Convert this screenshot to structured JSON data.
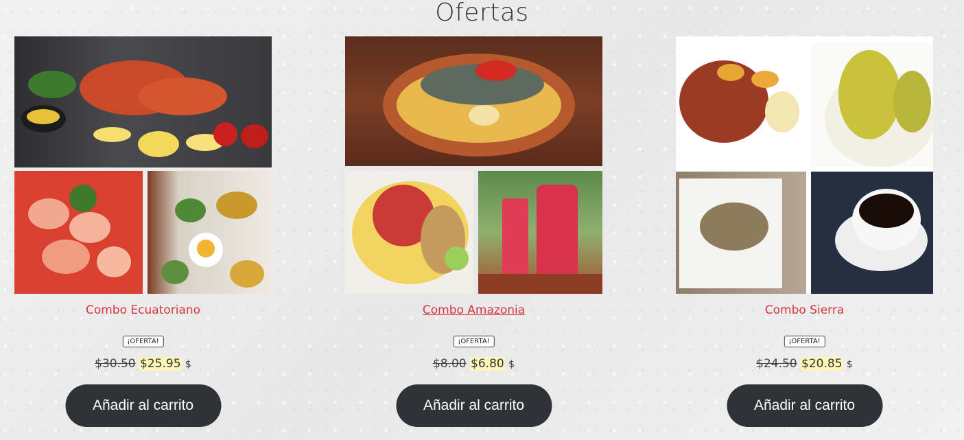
{
  "section": {
    "title": "Ofertas"
  },
  "products": [
    {
      "name": "Combo Ecuatoriano",
      "badge": "¡OFERTA!",
      "old_price": "$30.50",
      "new_price": "$25.95",
      "currency": "$",
      "button": "Añadir al carrito"
    },
    {
      "name": "Combo Amazonia",
      "badge": "¡OFERTA!",
      "old_price": "$8.00",
      "new_price": "$6.80",
      "currency": "$",
      "button": "Añadir al carrito"
    },
    {
      "name": "Combo Sierra",
      "badge": "¡OFERTA!",
      "old_price": "$24.50",
      "new_price": "$20.85",
      "currency": "$",
      "button": "Añadir al carrito"
    }
  ],
  "colors": {
    "accent": "#d6353f",
    "button": "#2f3337",
    "highlight": "#fff7b8"
  }
}
